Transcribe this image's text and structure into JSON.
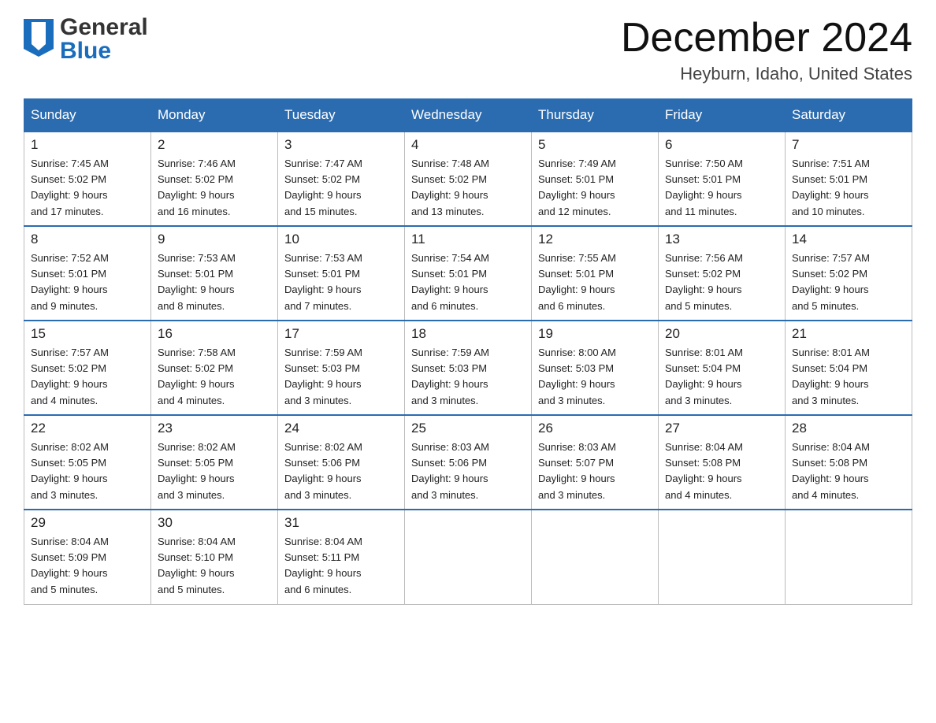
{
  "header": {
    "logo_general": "General",
    "logo_blue": "Blue",
    "month_title": "December 2024",
    "location": "Heyburn, Idaho, United States"
  },
  "days_of_week": [
    "Sunday",
    "Monday",
    "Tuesday",
    "Wednesday",
    "Thursday",
    "Friday",
    "Saturday"
  ],
  "weeks": [
    [
      {
        "date": "1",
        "sunrise": "7:45 AM",
        "sunset": "5:02 PM",
        "daylight": "9 hours and 17 minutes."
      },
      {
        "date": "2",
        "sunrise": "7:46 AM",
        "sunset": "5:02 PM",
        "daylight": "9 hours and 16 minutes."
      },
      {
        "date": "3",
        "sunrise": "7:47 AM",
        "sunset": "5:02 PM",
        "daylight": "9 hours and 15 minutes."
      },
      {
        "date": "4",
        "sunrise": "7:48 AM",
        "sunset": "5:02 PM",
        "daylight": "9 hours and 13 minutes."
      },
      {
        "date": "5",
        "sunrise": "7:49 AM",
        "sunset": "5:01 PM",
        "daylight": "9 hours and 12 minutes."
      },
      {
        "date": "6",
        "sunrise": "7:50 AM",
        "sunset": "5:01 PM",
        "daylight": "9 hours and 11 minutes."
      },
      {
        "date": "7",
        "sunrise": "7:51 AM",
        "sunset": "5:01 PM",
        "daylight": "9 hours and 10 minutes."
      }
    ],
    [
      {
        "date": "8",
        "sunrise": "7:52 AM",
        "sunset": "5:01 PM",
        "daylight": "9 hours and 9 minutes."
      },
      {
        "date": "9",
        "sunrise": "7:53 AM",
        "sunset": "5:01 PM",
        "daylight": "9 hours and 8 minutes."
      },
      {
        "date": "10",
        "sunrise": "7:53 AM",
        "sunset": "5:01 PM",
        "daylight": "9 hours and 7 minutes."
      },
      {
        "date": "11",
        "sunrise": "7:54 AM",
        "sunset": "5:01 PM",
        "daylight": "9 hours and 6 minutes."
      },
      {
        "date": "12",
        "sunrise": "7:55 AM",
        "sunset": "5:01 PM",
        "daylight": "9 hours and 6 minutes."
      },
      {
        "date": "13",
        "sunrise": "7:56 AM",
        "sunset": "5:02 PM",
        "daylight": "9 hours and 5 minutes."
      },
      {
        "date": "14",
        "sunrise": "7:57 AM",
        "sunset": "5:02 PM",
        "daylight": "9 hours and 5 minutes."
      }
    ],
    [
      {
        "date": "15",
        "sunrise": "7:57 AM",
        "sunset": "5:02 PM",
        "daylight": "9 hours and 4 minutes."
      },
      {
        "date": "16",
        "sunrise": "7:58 AM",
        "sunset": "5:02 PM",
        "daylight": "9 hours and 4 minutes."
      },
      {
        "date": "17",
        "sunrise": "7:59 AM",
        "sunset": "5:03 PM",
        "daylight": "9 hours and 3 minutes."
      },
      {
        "date": "18",
        "sunrise": "7:59 AM",
        "sunset": "5:03 PM",
        "daylight": "9 hours and 3 minutes."
      },
      {
        "date": "19",
        "sunrise": "8:00 AM",
        "sunset": "5:03 PM",
        "daylight": "9 hours and 3 minutes."
      },
      {
        "date": "20",
        "sunrise": "8:01 AM",
        "sunset": "5:04 PM",
        "daylight": "9 hours and 3 minutes."
      },
      {
        "date": "21",
        "sunrise": "8:01 AM",
        "sunset": "5:04 PM",
        "daylight": "9 hours and 3 minutes."
      }
    ],
    [
      {
        "date": "22",
        "sunrise": "8:02 AM",
        "sunset": "5:05 PM",
        "daylight": "9 hours and 3 minutes."
      },
      {
        "date": "23",
        "sunrise": "8:02 AM",
        "sunset": "5:05 PM",
        "daylight": "9 hours and 3 minutes."
      },
      {
        "date": "24",
        "sunrise": "8:02 AM",
        "sunset": "5:06 PM",
        "daylight": "9 hours and 3 minutes."
      },
      {
        "date": "25",
        "sunrise": "8:03 AM",
        "sunset": "5:06 PM",
        "daylight": "9 hours and 3 minutes."
      },
      {
        "date": "26",
        "sunrise": "8:03 AM",
        "sunset": "5:07 PM",
        "daylight": "9 hours and 3 minutes."
      },
      {
        "date": "27",
        "sunrise": "8:04 AM",
        "sunset": "5:08 PM",
        "daylight": "9 hours and 4 minutes."
      },
      {
        "date": "28",
        "sunrise": "8:04 AM",
        "sunset": "5:08 PM",
        "daylight": "9 hours and 4 minutes."
      }
    ],
    [
      {
        "date": "29",
        "sunrise": "8:04 AM",
        "sunset": "5:09 PM",
        "daylight": "9 hours and 5 minutes."
      },
      {
        "date": "30",
        "sunrise": "8:04 AM",
        "sunset": "5:10 PM",
        "daylight": "9 hours and 5 minutes."
      },
      {
        "date": "31",
        "sunrise": "8:04 AM",
        "sunset": "5:11 PM",
        "daylight": "9 hours and 6 minutes."
      },
      null,
      null,
      null,
      null
    ]
  ],
  "labels": {
    "sunrise": "Sunrise:",
    "sunset": "Sunset:",
    "daylight": "Daylight:"
  }
}
